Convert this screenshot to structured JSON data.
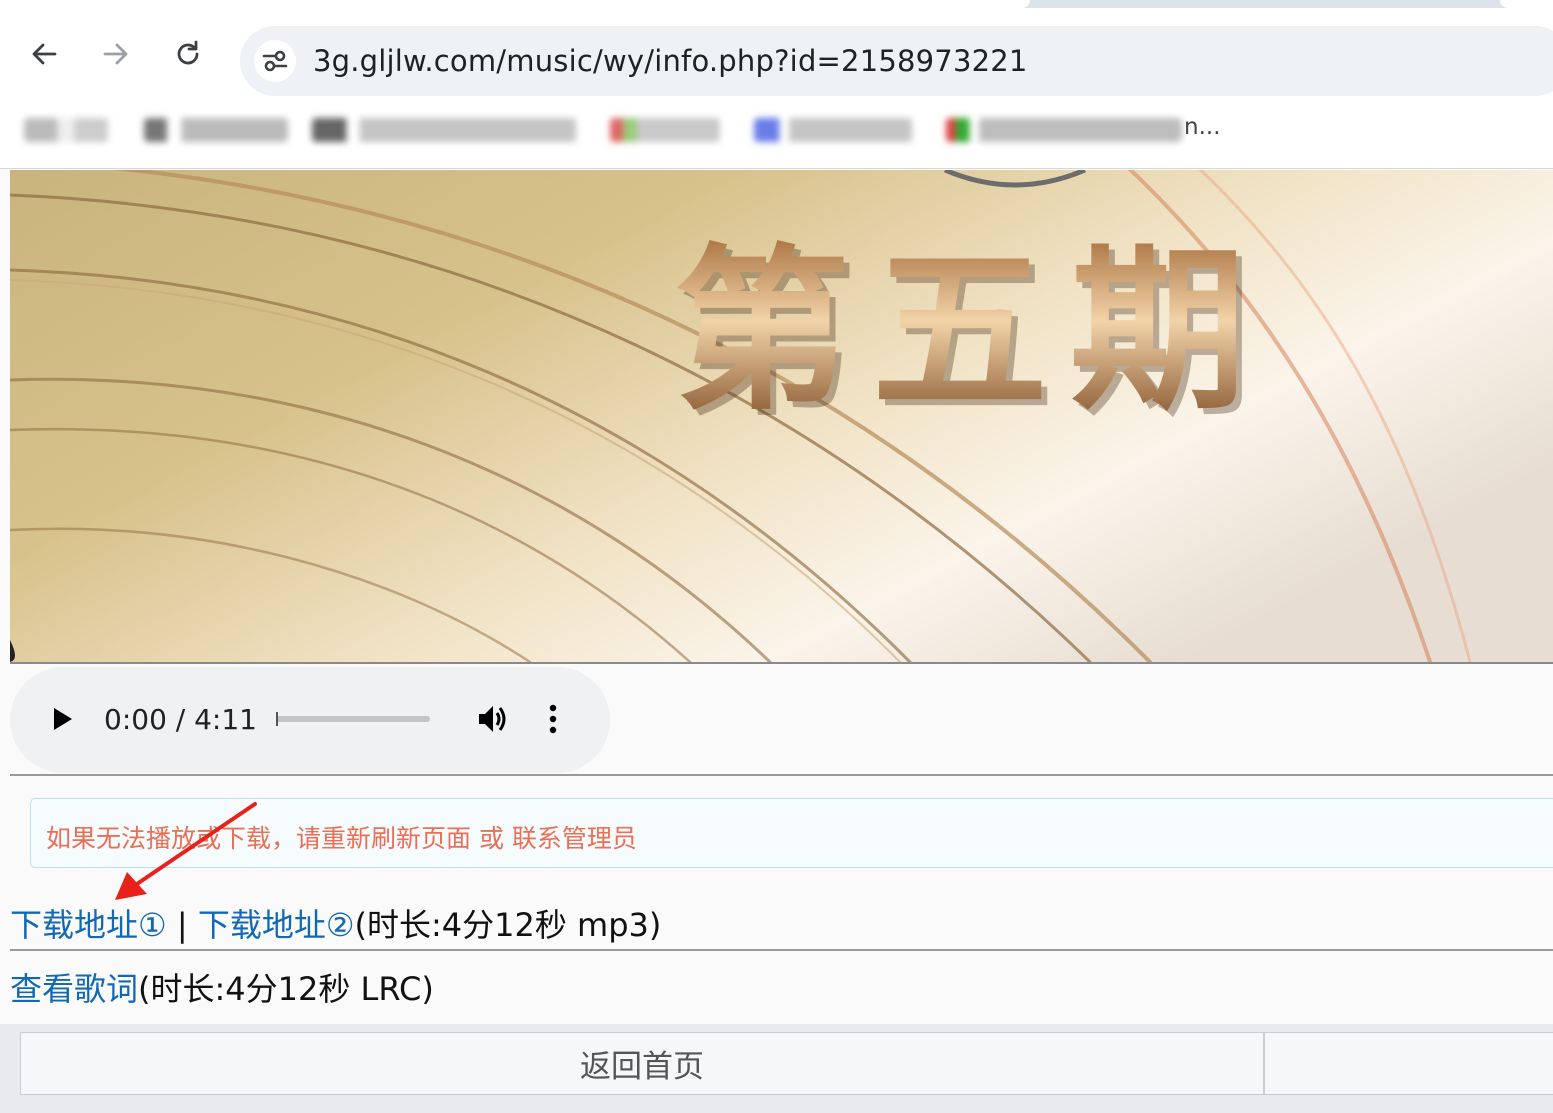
{
  "browser": {
    "url": "3g.gljlw.com/music/wy/info.php?id=2158973221",
    "bookmarks_ellipsis": "n..."
  },
  "cover": {
    "title_text": "第五期"
  },
  "player": {
    "time_display": "0:00 / 4:11",
    "progress": 0
  },
  "notice": {
    "text": "如果无法播放或下载，请重新刷新页面 或 联系管理员"
  },
  "downloads": {
    "link1": "下载地址①",
    "separator": " | ",
    "link2": "下载地址②",
    "info": "(时长:4分12秒 mp3)"
  },
  "lyrics": {
    "link": "查看歌词",
    "info": "(时长:4分12秒 LRC)"
  },
  "footer": {
    "home_button": "返回首页"
  },
  "colors": {
    "link": "#1268b3",
    "notice_text": "#ea6f54",
    "notice_border": "#b8e2ef",
    "annotation_arrow": "#e8221b"
  }
}
